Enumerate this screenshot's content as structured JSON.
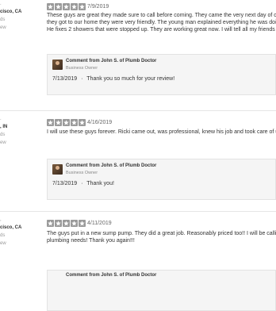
{
  "reviews": [
    {
      "location": "cisco, CA",
      "line2": "ds",
      "line3": "ew",
      "rating": 5,
      "date": "7/9/2019",
      "text": [
        "These guys are great they made sure to call before coming. They came the very next day of calling",
        "they got to our home they were very friendly. The young man explained everything he was doing be",
        "He fixes 2 showers that were stopped up. They are working great now. I will tell all my friends abou"
      ],
      "reply": {
        "name": "Comment from John S. of Plumb Doctor",
        "role": "Business Owner",
        "date": "7/13/2019",
        "text": "Thank you so much for your review!"
      }
    },
    {
      "location": ", IN",
      "line2": "ds",
      "line3": "ew",
      "rating": 5,
      "date": "4/16/2019",
      "text": [
        "I will use these guys forever. Ricki came out, was professional, knew his job and took care of us. Th"
      ],
      "reply": {
        "name": "Comment from John S. of Plumb Doctor",
        "role": "Business Owner",
        "date": "7/13/2019",
        "text": "Thank you!"
      }
    },
    {
      "location": "cisco, CA",
      "line2": "ds",
      "line3": "ew",
      "rating": 5,
      "date": "4/11/2019",
      "text": [
        "The guys put in a new sump pump. They did a great job. Reasonably priced too!! I will be calling yo",
        "plumbing needs! Thank you again!!!"
      ],
      "reply": {
        "name": "Comment from John S. of Plumb Doctor"
      }
    }
  ],
  "separator": "·",
  "colors": {
    "star_fill": "#9a9a9a",
    "box_bg": "#f5f5f5"
  }
}
